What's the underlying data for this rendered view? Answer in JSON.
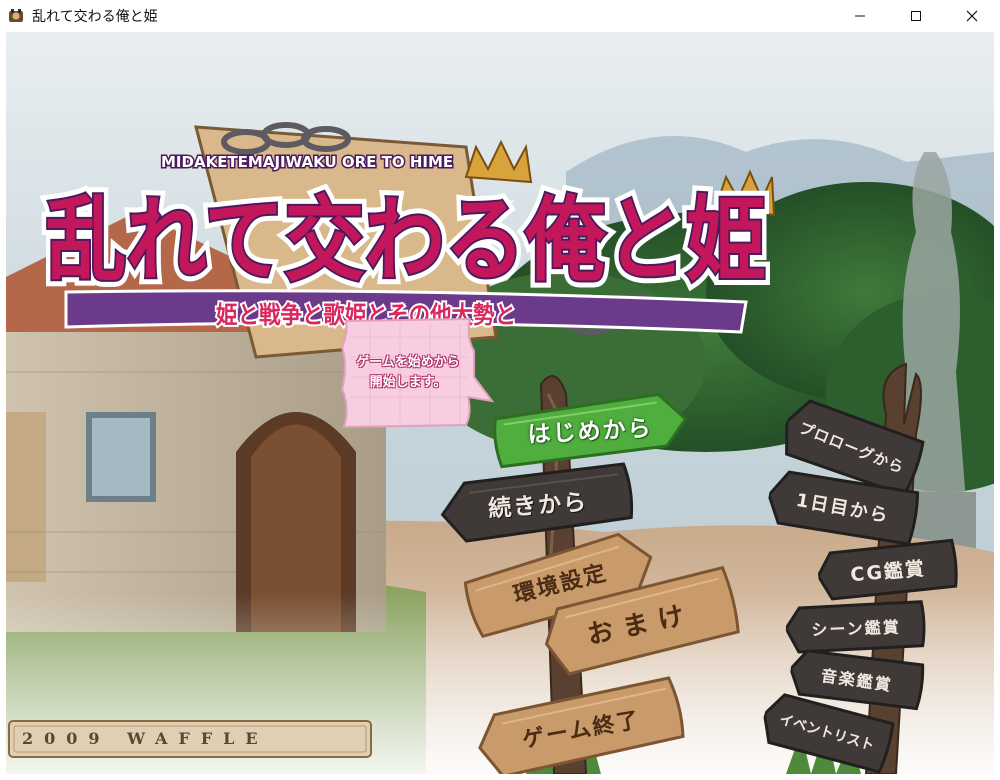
{
  "window": {
    "title": "乱れて交わる俺と姫",
    "icon": "game-app-icon",
    "controls": [
      "minimize-icon",
      "maximize-icon",
      "close-icon"
    ]
  },
  "logo": {
    "romaji": "MIDAKETEMAJIWAKU ORE TO HIME",
    "main": "乱れて交わる俺と姫",
    "subtitle": "姫と戦争と歌姫とその他大勢と",
    "colors": {
      "main_fill": "#c2185b",
      "outline": "#4a1a5c",
      "gold": "#d8a33a"
    }
  },
  "tooltip": {
    "line1": "ゲームを始めから",
    "line2": "開始します。"
  },
  "left_signpost": {
    "new_game": "はじめから",
    "continue": "続きから",
    "settings": "環境設定",
    "extras": "おまけ",
    "quit": "ゲーム終了"
  },
  "right_signpost": {
    "prologue": "プロローグから",
    "day1": "1日目から",
    "cg_gallery": "CG鑑賞",
    "scene_gallery": "シーン鑑賞",
    "music_gallery": "音楽鑑賞",
    "event_list": "イベントリスト"
  },
  "copyright": "2009 WAFFLE",
  "colors": {
    "sign_dark": "#3f3a38",
    "sign_light": "#c99a6a",
    "sign_selected": "#4fae3d",
    "sign_text_dark": "#f1e8df",
    "sign_text_light": "#4b2b14"
  }
}
